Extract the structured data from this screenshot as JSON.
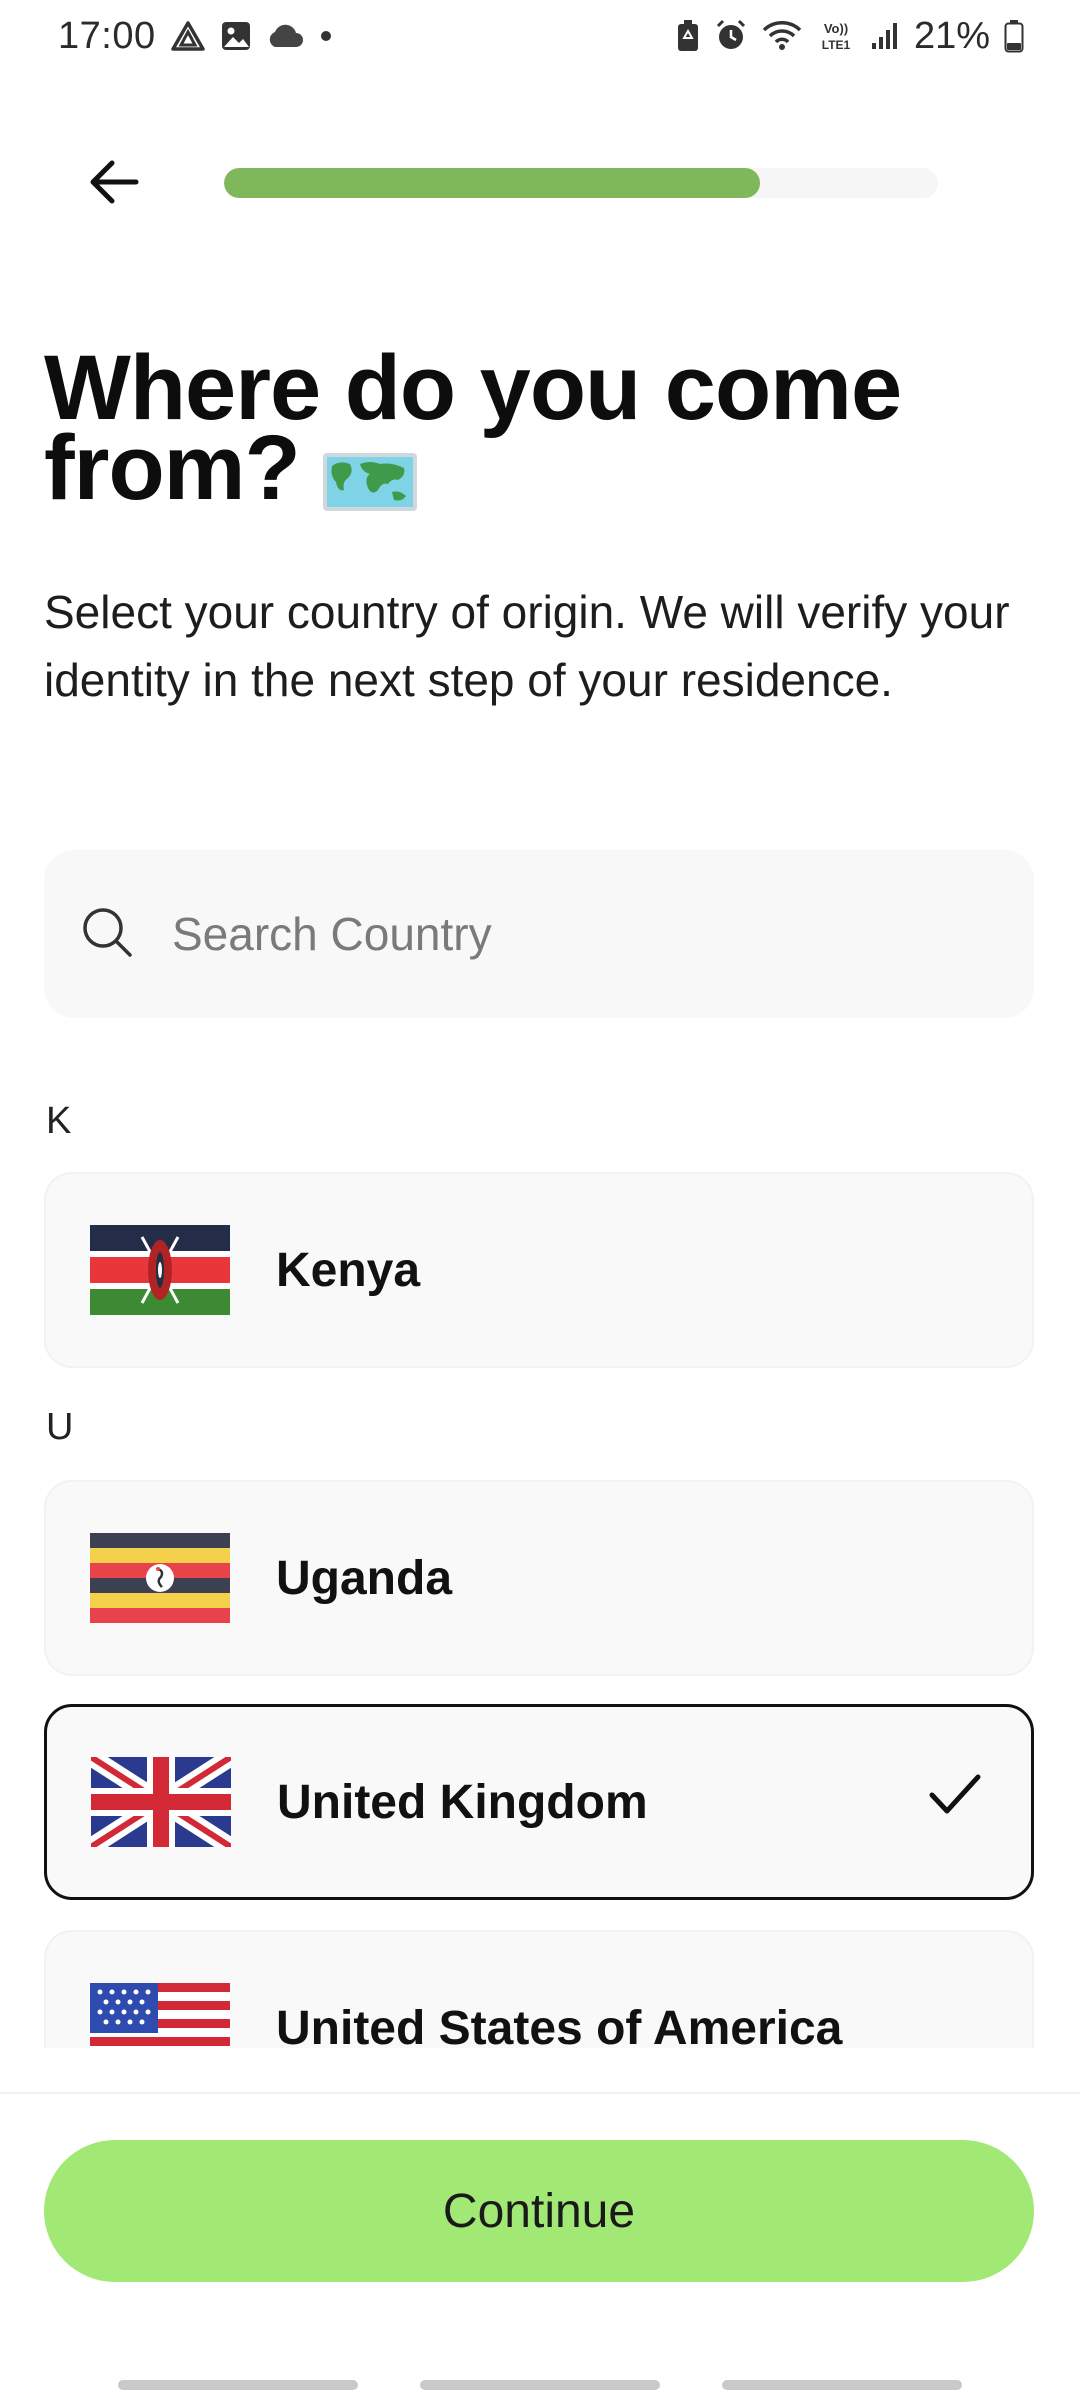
{
  "status_bar": {
    "time": "17:00",
    "battery_percent": "21%",
    "icons": [
      "drive-icon",
      "gallery-icon",
      "cloud-icon",
      "dot-icon",
      "battery-saver-icon",
      "alarm-icon",
      "wifi-icon",
      "volte-icon",
      "signal-icon",
      "battery-icon"
    ]
  },
  "header": {
    "back_icon": "arrow-left-icon",
    "progress": 0.75
  },
  "title": {
    "line1": "Where do you come",
    "line2": "from?",
    "emoji": "world-map-icon"
  },
  "subtitle": "Select your country of origin. We will verify your identity in the next step of your residence.",
  "search": {
    "placeholder": "Search Country",
    "value": ""
  },
  "sections": [
    {
      "letter": "K",
      "countries": [
        {
          "name": "Kenya",
          "flag": "kenya-flag",
          "selected": false
        }
      ]
    },
    {
      "letter": "U",
      "countries": [
        {
          "name": "Uganda",
          "flag": "uganda-flag",
          "selected": false
        },
        {
          "name": "United Kingdom",
          "flag": "uk-flag",
          "selected": true
        },
        {
          "name": "United States of America",
          "flag": "usa-flag",
          "selected": false
        }
      ]
    }
  ],
  "continue_label": "Continue",
  "colors": {
    "progress_fill": "#7fb85a",
    "progress_track": "#f6f6f6",
    "continue_button": "#a2e874",
    "card_background": "#f9f9f9",
    "selected_border": "#111111"
  }
}
